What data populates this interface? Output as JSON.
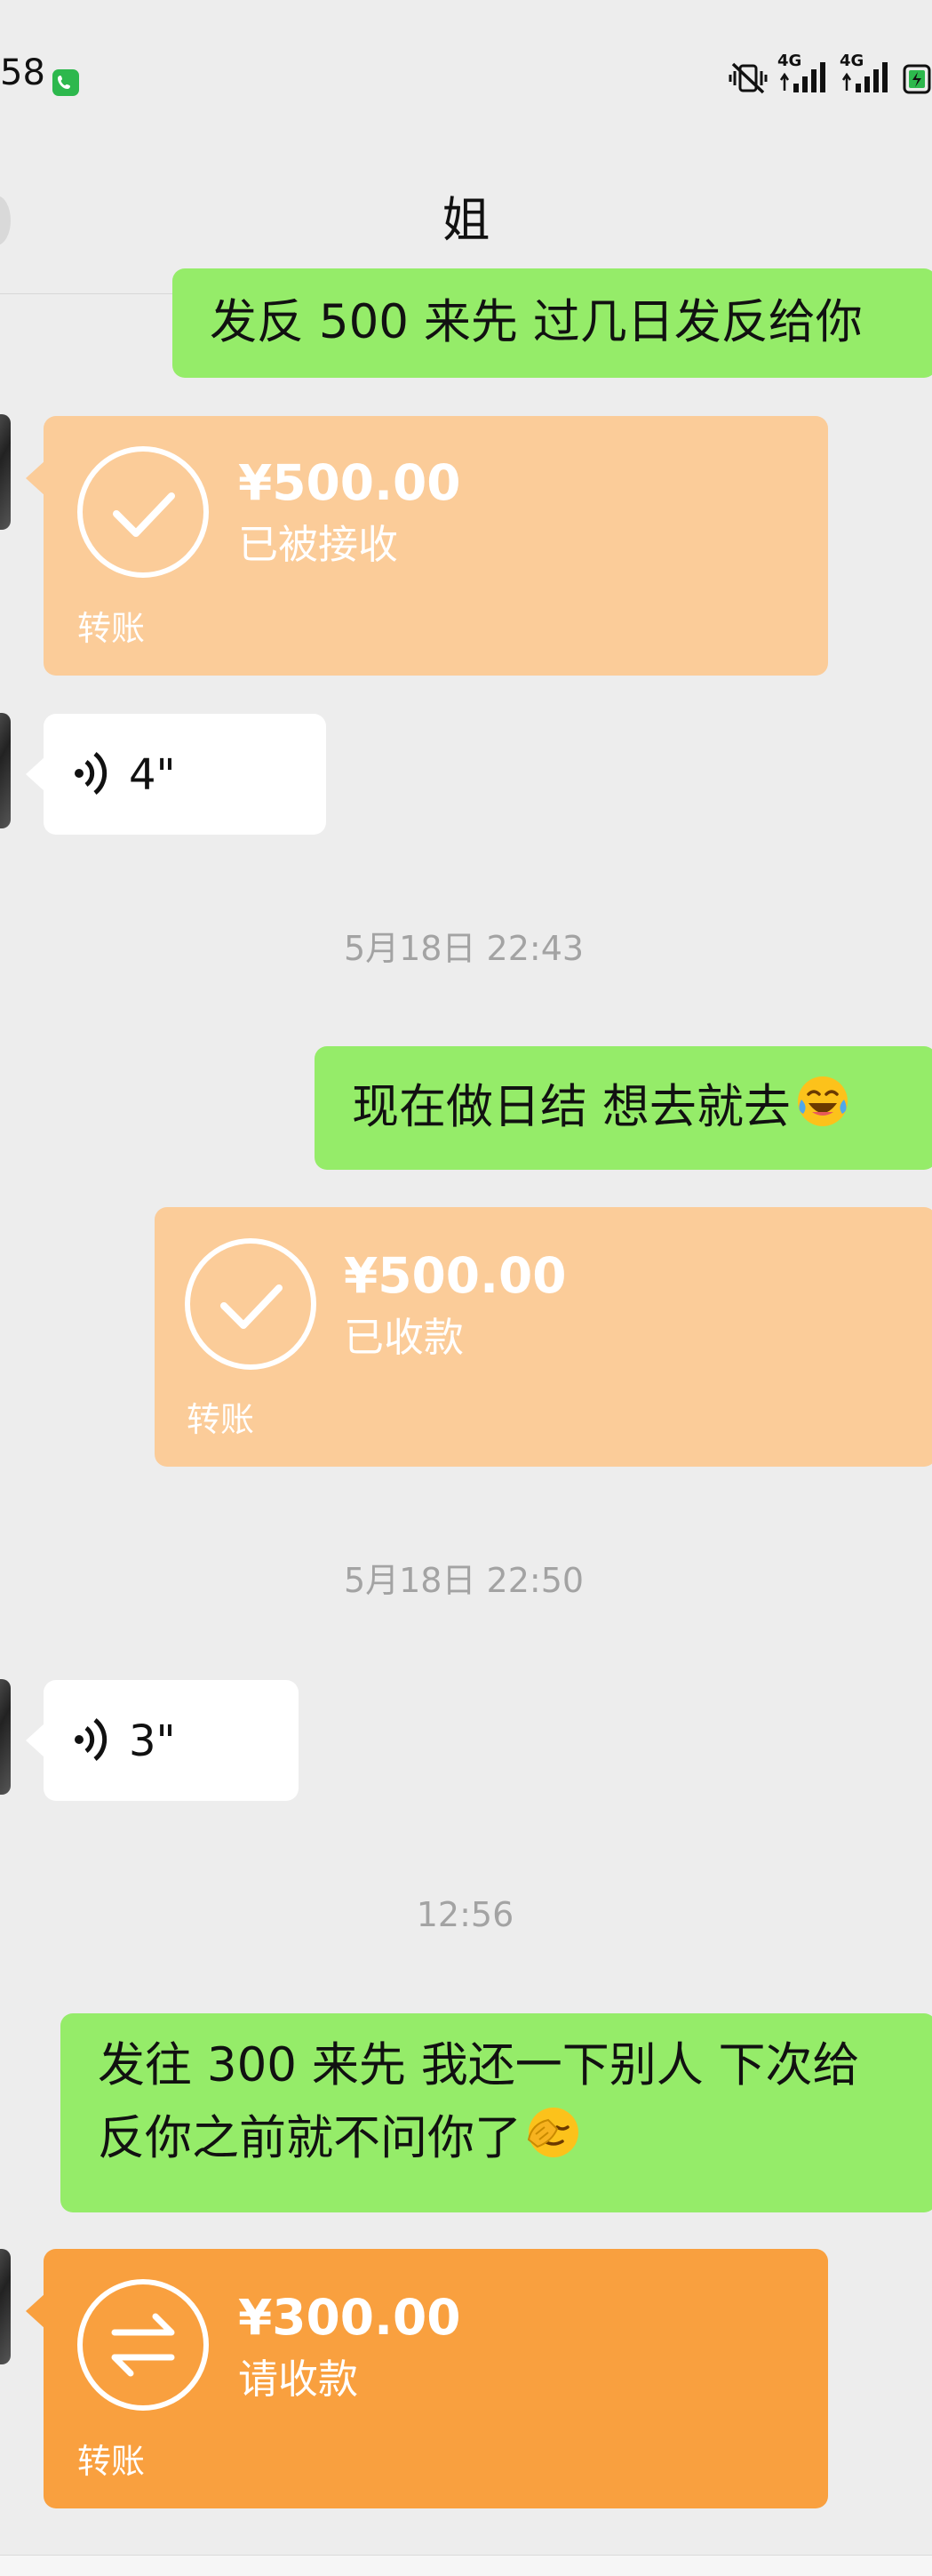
{
  "status_bar": {
    "time": "58",
    "network_1": "4G",
    "network_2": "4G"
  },
  "nav": {
    "title": "姐"
  },
  "messages": {
    "m1_text": "发反 500 来先  过几日发反给你",
    "m2_amount": "¥500.00",
    "m2_status": "已被接收",
    "m2_label": "转账",
    "m3_duration": "4\"",
    "ts1": "5月18日 22:43",
    "m4_text": "现在做日结  想去就去",
    "m5_amount": "¥500.00",
    "m5_status": "已收款",
    "m5_label": "转账",
    "ts2": "5月18日 22:50",
    "m6_duration": "3\"",
    "ts3": "12:56",
    "m7_line1": "发往 300 来先  我还一下别人  下次给",
    "m7_line2": "反你之前就不问你了",
    "m8_amount": "¥300.00",
    "m8_status": "请收款",
    "m8_label": "转账"
  },
  "colors": {
    "background": "#ededed",
    "own_bubble": "#95ec69",
    "transfer_received": "#fbcc99",
    "transfer_request": "#f9a03f",
    "voice_bubble": "#ffffff",
    "timestamp_text": "#a3a3a3"
  },
  "icons": {
    "call": "phone-call-icon",
    "mute": "vibrate-mute-icon",
    "signal": "cellular-signal-icon",
    "battery": "battery-charging-icon",
    "received": "check-circle-icon",
    "request": "transfer-arrows-icon",
    "voice": "voice-wave-icon",
    "emoji_laugh": "tears-of-joy-emoji",
    "emoji_facepalm": "face-palm-emoji"
  }
}
